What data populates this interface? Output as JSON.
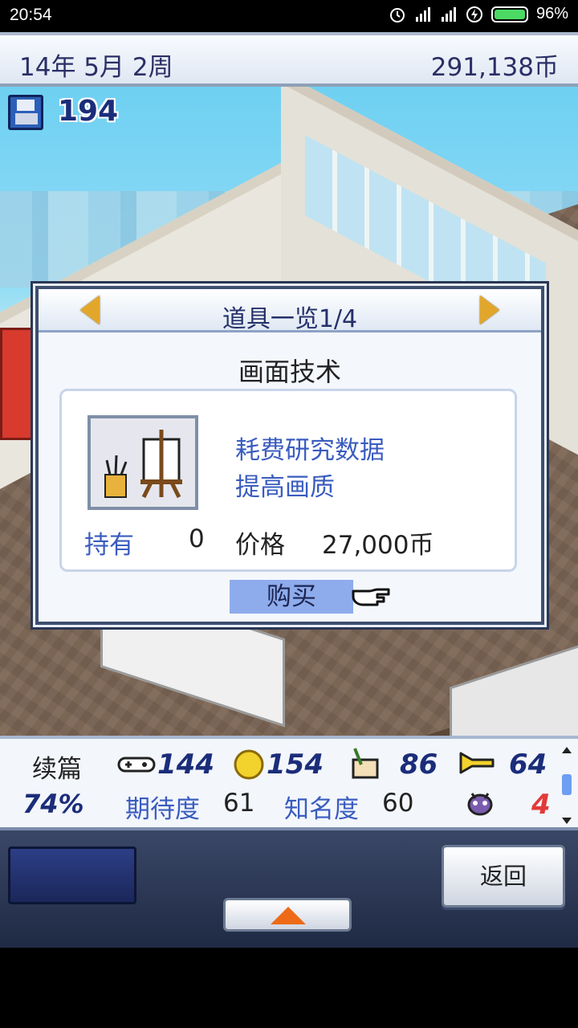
{
  "status_bar": {
    "time": "20:54",
    "battery": "96%",
    "icons": [
      "alarm-icon",
      "signal-icon",
      "signal-icon",
      "charging-icon",
      "battery-icon"
    ]
  },
  "topbar": {
    "date": "14年 5月 2周",
    "money": "291,138币"
  },
  "hud": {
    "save_icon": "floppy-disk-icon",
    "save_count": "194"
  },
  "dialog": {
    "title": "道具一览1/4",
    "item_name": "画面技术",
    "item_icon": "easel-brush-icon",
    "desc_line1": "耗费研究数据",
    "desc_line2": "提高画质",
    "own_label": "持有",
    "own_value": "0",
    "price_label": "价格",
    "price_value": "27,000币",
    "buy_label": "购买",
    "pointer_icon": "pointing-hand-icon"
  },
  "stats": {
    "sequel_label": "续篇",
    "progress_pct": "74%",
    "fun": "144",
    "creativity": "154",
    "graphics": "86",
    "sound": "64",
    "expectation_label": "期待度",
    "expectation_value": "61",
    "fame_label": "知名度",
    "fame_value": "60",
    "bugs": "4"
  },
  "controls": {
    "back_label": "返回"
  },
  "colors": {
    "accent_blue": "#3a5cbf",
    "title_navy": "#25306a",
    "buy_highlight": "#8eacec",
    "arrow_gold": "#e2a72a",
    "bug_red": "#e23a3a"
  }
}
